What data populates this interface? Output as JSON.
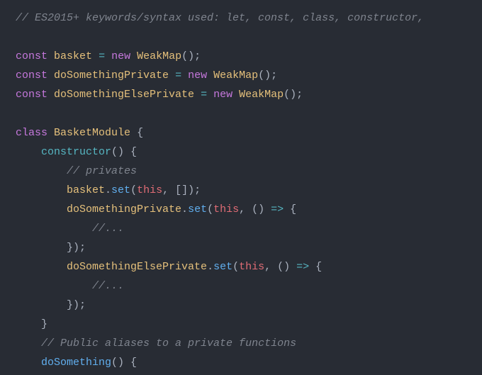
{
  "code": {
    "lines": [
      [
        {
          "cls": "tok-comment",
          "t": "// ES2015+ keywords/syntax used: let, const, class, constructor,"
        }
      ],
      [],
      [
        {
          "cls": "tok-keyword",
          "t": "const"
        },
        {
          "cls": "tok-plain",
          "t": " "
        },
        {
          "cls": "tok-ident",
          "t": "basket"
        },
        {
          "cls": "tok-plain",
          "t": " "
        },
        {
          "cls": "tok-op",
          "t": "="
        },
        {
          "cls": "tok-plain",
          "t": " "
        },
        {
          "cls": "tok-keyword",
          "t": "new"
        },
        {
          "cls": "tok-plain",
          "t": " "
        },
        {
          "cls": "tok-classname",
          "t": "WeakMap"
        },
        {
          "cls": "tok-punct",
          "t": "();"
        }
      ],
      [
        {
          "cls": "tok-keyword",
          "t": "const"
        },
        {
          "cls": "tok-plain",
          "t": " "
        },
        {
          "cls": "tok-ident",
          "t": "doSomethingPrivate"
        },
        {
          "cls": "tok-plain",
          "t": " "
        },
        {
          "cls": "tok-op",
          "t": "="
        },
        {
          "cls": "tok-plain",
          "t": " "
        },
        {
          "cls": "tok-keyword",
          "t": "new"
        },
        {
          "cls": "tok-plain",
          "t": " "
        },
        {
          "cls": "tok-classname",
          "t": "WeakMap"
        },
        {
          "cls": "tok-punct",
          "t": "();"
        }
      ],
      [
        {
          "cls": "tok-keyword",
          "t": "const"
        },
        {
          "cls": "tok-plain",
          "t": " "
        },
        {
          "cls": "tok-ident",
          "t": "doSomethingElsePrivate"
        },
        {
          "cls": "tok-plain",
          "t": " "
        },
        {
          "cls": "tok-op",
          "t": "="
        },
        {
          "cls": "tok-plain",
          "t": " "
        },
        {
          "cls": "tok-keyword",
          "t": "new"
        },
        {
          "cls": "tok-plain",
          "t": " "
        },
        {
          "cls": "tok-classname",
          "t": "WeakMap"
        },
        {
          "cls": "tok-punct",
          "t": "();"
        }
      ],
      [],
      [
        {
          "cls": "tok-keyword",
          "t": "class"
        },
        {
          "cls": "tok-plain",
          "t": " "
        },
        {
          "cls": "tok-classname",
          "t": "BasketModule"
        },
        {
          "cls": "tok-plain",
          "t": " "
        },
        {
          "cls": "tok-punct",
          "t": "{"
        }
      ],
      [
        {
          "cls": "tok-plain",
          "t": "    "
        },
        {
          "cls": "tok-ctor",
          "t": "constructor"
        },
        {
          "cls": "tok-punct",
          "t": "() {"
        }
      ],
      [
        {
          "cls": "tok-plain",
          "t": "        "
        },
        {
          "cls": "tok-comment",
          "t": "// privates"
        }
      ],
      [
        {
          "cls": "tok-plain",
          "t": "        "
        },
        {
          "cls": "tok-ident",
          "t": "basket"
        },
        {
          "cls": "tok-punct",
          "t": "."
        },
        {
          "cls": "tok-method",
          "t": "set"
        },
        {
          "cls": "tok-punct",
          "t": "("
        },
        {
          "cls": "tok-this",
          "t": "this"
        },
        {
          "cls": "tok-punct",
          "t": ", []);"
        }
      ],
      [
        {
          "cls": "tok-plain",
          "t": "        "
        },
        {
          "cls": "tok-ident",
          "t": "doSomethingPrivate"
        },
        {
          "cls": "tok-punct",
          "t": "."
        },
        {
          "cls": "tok-method",
          "t": "set"
        },
        {
          "cls": "tok-punct",
          "t": "("
        },
        {
          "cls": "tok-this",
          "t": "this"
        },
        {
          "cls": "tok-punct",
          "t": ", () "
        },
        {
          "cls": "tok-op",
          "t": "=>"
        },
        {
          "cls": "tok-punct",
          "t": " {"
        }
      ],
      [
        {
          "cls": "tok-plain",
          "t": "            "
        },
        {
          "cls": "tok-comment",
          "t": "//..."
        }
      ],
      [
        {
          "cls": "tok-plain",
          "t": "        "
        },
        {
          "cls": "tok-punct",
          "t": "});"
        }
      ],
      [
        {
          "cls": "tok-plain",
          "t": "        "
        },
        {
          "cls": "tok-ident",
          "t": "doSomethingElsePrivate"
        },
        {
          "cls": "tok-punct",
          "t": "."
        },
        {
          "cls": "tok-method",
          "t": "set"
        },
        {
          "cls": "tok-punct",
          "t": "("
        },
        {
          "cls": "tok-this",
          "t": "this"
        },
        {
          "cls": "tok-punct",
          "t": ", () "
        },
        {
          "cls": "tok-op",
          "t": "=>"
        },
        {
          "cls": "tok-punct",
          "t": " {"
        }
      ],
      [
        {
          "cls": "tok-plain",
          "t": "            "
        },
        {
          "cls": "tok-comment",
          "t": "//..."
        }
      ],
      [
        {
          "cls": "tok-plain",
          "t": "        "
        },
        {
          "cls": "tok-punct",
          "t": "});"
        }
      ],
      [
        {
          "cls": "tok-plain",
          "t": "    "
        },
        {
          "cls": "tok-punct",
          "t": "}"
        }
      ],
      [
        {
          "cls": "tok-plain",
          "t": "    "
        },
        {
          "cls": "tok-comment",
          "t": "// Public aliases to a private functions"
        }
      ],
      [
        {
          "cls": "tok-plain",
          "t": "    "
        },
        {
          "cls": "tok-funcdecl",
          "t": "doSomething"
        },
        {
          "cls": "tok-punct",
          "t": "() {"
        }
      ]
    ]
  }
}
